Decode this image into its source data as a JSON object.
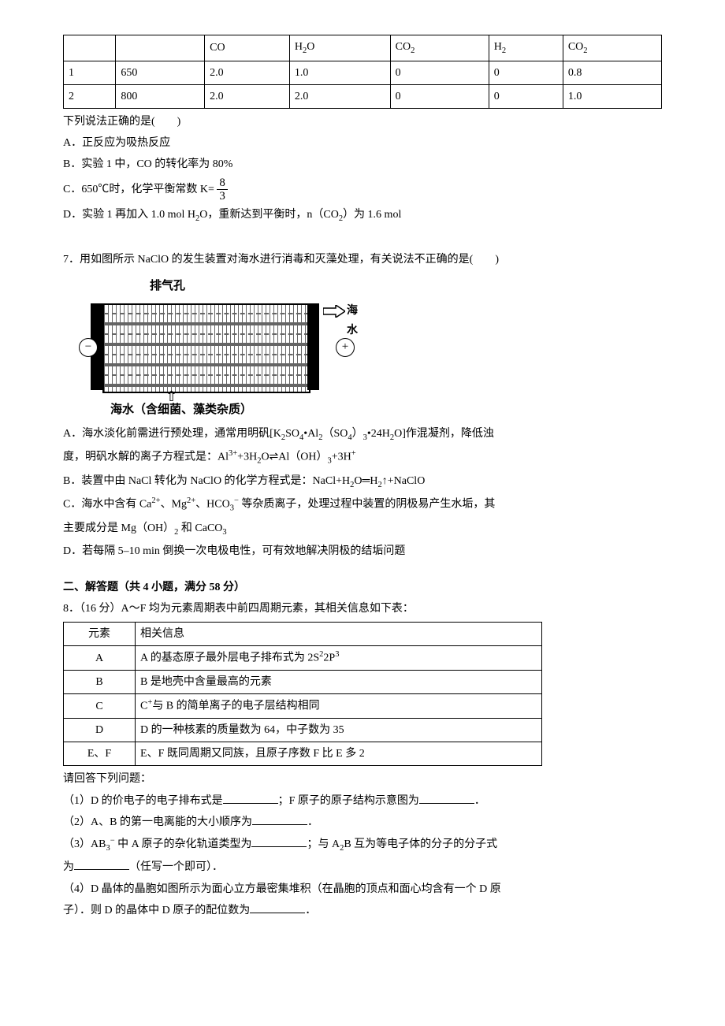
{
  "table1": {
    "headers": [
      "",
      "",
      "CO",
      "H2O",
      "CO2",
      "H2",
      "CO2"
    ],
    "rows": [
      [
        "1",
        "650",
        "2.0",
        "1.0",
        "0",
        "0",
        "0.8"
      ],
      [
        "2",
        "800",
        "2.0",
        "2.0",
        "0",
        "0",
        "1.0"
      ]
    ]
  },
  "q_pre": "下列说法正确的是(　　)",
  "optA": "A．正反应为吸热反应",
  "optB": "B．实验 1 中，CO 的转化率为 80%",
  "optC_pre": "C．650℃时，化学平衡常数 K=",
  "frac_num": "8",
  "frac_den": "3",
  "optD": "D．实验 1 再加入 1.0 mol H2O，重新达到平衡时，n（CO2）为 1.6 mol",
  "q7": "7．用如图所示 NaClO 的发生装置对海水进行消毒和灭藻处理，有关说法不正确的是(　　)",
  "d7": {
    "vent": "排气孔",
    "in": "海水",
    "out": "海水（含细菌、藻类杂质）",
    "minus": "−",
    "plus": "+"
  },
  "q7A_1": "A．海水淡化前需进行预处理，通常用明矾[K2SO4•Al2（SO4）3•24H2O]作混凝剂，降低浊",
  "q7A_2": "度，明矾水解的离子方程式是：Al3++3H2O⇌Al（OH）3+3H+",
  "q7B": "B．装置中由 NaCl 转化为 NaClO 的化学方程式是：NaCl+H2O═H2↑+NaClO",
  "q7C_1": "C．海水中含有 Ca2+、Mg2+、HCO3− 等杂质离子，处理过程中装置的阴极易产生水垢，其",
  "q7C_2": "主要成分是 Mg（OH）2 和 CaCO3",
  "q7D": "D．若每隔 5–10 min 倒换一次电极电性，可有效地解决阴极的结垢问题",
  "sect2": "二、解答题（共 4 小题，满分 58 分）",
  "q8": "8．（16 分）A～F 均为元素周期表中前四周期元素，其相关信息如下表：",
  "table8": {
    "header": [
      "元素",
      "相关信息"
    ],
    "rows": [
      [
        "A",
        "A 的基态原子最外层电子排布式为 2S22P3"
      ],
      [
        "B",
        "B 是地壳中含量最高的元素"
      ],
      [
        "C",
        "C+与 B 的简单离子的电子层结构相同"
      ],
      [
        "D",
        "D 的一种核素的质量数为 64，中子数为 35"
      ],
      [
        "E、F",
        "E、F 既同周期又同族，且原子序数 F 比 E 多 2"
      ]
    ]
  },
  "q8_lead": "请回答下列问题：",
  "q8_1a": "（1）D 的价电子的电子排布式是",
  "q8_1b": "；F 原子的原子结构示意图为",
  "dot": "．",
  "q8_2": "（2）A、B 的第一电离能的大小顺序为",
  "q8_3a": "（3）AB3− 中 A 原子的杂化轨道类型为",
  "q8_3b": "；与 A2B 互为等电子体的分子的分子式",
  "q8_3c": "为",
  "q8_3d": "（任写一个即可）．",
  "q8_4a": "（4）D 晶体的晶胞如图所示为面心立方最密集堆积（在晶胞的顶点和面心均含有一个 D 原",
  "q8_4b": "子）．则 D 的晶体中 D 原子的配位数为"
}
